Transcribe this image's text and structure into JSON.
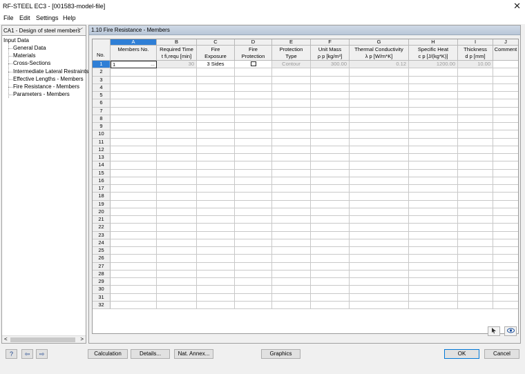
{
  "window": {
    "title": "RF-STEEL EC3 - [001583-model-file]"
  },
  "menu": [
    "File",
    "Edit",
    "Settings",
    "Help"
  ],
  "left_panel": {
    "case_selector": "CA1 - Design of steel members",
    "tree_root": "Input Data",
    "tree_items": [
      "General Data",
      "Materials",
      "Cross-Sections",
      "Intermediate Lateral Restraints",
      "Effective Lengths - Members",
      "Fire Resistance - Members",
      "Parameters - Members"
    ]
  },
  "section": {
    "title": "1.10 Fire Resistance - Members"
  },
  "table": {
    "no_header": "No.",
    "columns": [
      {
        "letter": "A",
        "line1": "",
        "line2": "Members No."
      },
      {
        "letter": "B",
        "line1": "Required Time",
        "line2": "t fi,requ [min]"
      },
      {
        "letter": "C",
        "line1": "Fire",
        "line2": "Exposure"
      },
      {
        "letter": "D",
        "line1": "Fire",
        "line2": "Protection"
      },
      {
        "letter": "E",
        "line1": "Protection",
        "line2": "Type"
      },
      {
        "letter": "F",
        "line1": "Unit Mass",
        "line2": "ρ p [kg/m³]"
      },
      {
        "letter": "G",
        "line1": "Thermal Conductivity",
        "line2": "λ p [W/m*K]"
      },
      {
        "letter": "H",
        "line1": "Specific Heat",
        "line2": "c p [J/(kg*K)]"
      },
      {
        "letter": "I",
        "line1": "Thickness",
        "line2": "d p [mm]"
      },
      {
        "letter": "J",
        "line1": "",
        "line2": "Comment"
      }
    ],
    "row_count": 32,
    "row1": {
      "members_no": "1",
      "ellipsis": "...",
      "required_time": "30",
      "fire_exposure": "3 Sides",
      "protection_type": "Contour",
      "unit_mass": "300.00",
      "thermal_conductivity": "0.12",
      "specific_heat": "1200.00",
      "thickness": "10.00"
    }
  },
  "buttons": {
    "calculation": "Calculation",
    "details": "Details...",
    "nat_annex": "Nat. Annex...",
    "graphics": "Graphics",
    "ok": "OK",
    "cancel": "Cancel"
  },
  "icons": {
    "help": "help-icon",
    "import": "import-icon",
    "export": "export-icon",
    "pick": "pick-icon",
    "view": "eye-icon",
    "close": "close-icon"
  },
  "colors": {
    "selection": "#2f7fd6",
    "section_header": "#c5d1e0"
  }
}
